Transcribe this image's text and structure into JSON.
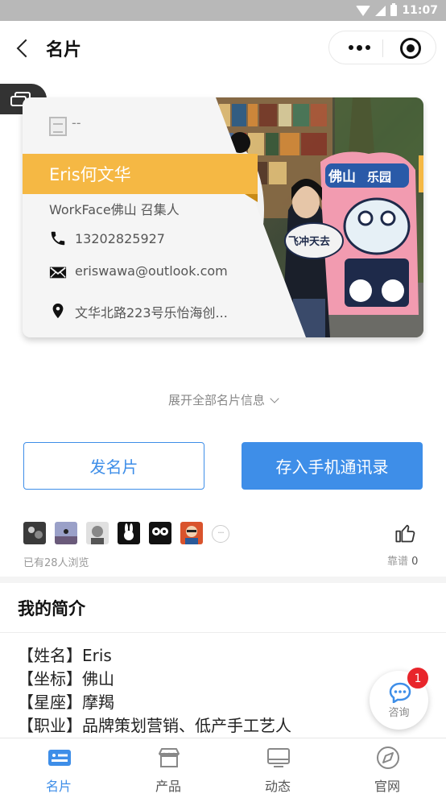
{
  "status_bar": {
    "time": "11:07",
    "icons": [
      "wifi-icon",
      "signal-icon",
      "battery-icon"
    ]
  },
  "header": {
    "back_icon": "chevron-left-icon",
    "title": "名片",
    "more_icon": "more-dots-icon",
    "close_icon": "target-circle-icon"
  },
  "card": {
    "company": "--",
    "name": "Eris何文华",
    "title": "WorkFace佛山 召集人",
    "phone": "13202825927",
    "email": "eriswawa@outlook.com",
    "address": "文华北路223号乐怡海创...",
    "accent_color": "#f5b844",
    "photo_sign": "佛山",
    "photo_sign_2": "乐园",
    "photo_board": "飞冲天去"
  },
  "expand_label": "展开全部名片信息",
  "buttons": {
    "send": "发名片",
    "save": "存入手机通讯录"
  },
  "visitors": {
    "count_text": "已有28人浏览",
    "more": "···",
    "avatars": [
      "avatar-1",
      "avatar-2",
      "avatar-3",
      "avatar-4",
      "avatar-5",
      "avatar-6"
    ]
  },
  "like": {
    "label": "靠谱",
    "count": "0"
  },
  "intro": {
    "title": "我的简介",
    "lines": [
      "【姓名】Eris",
      "【坐标】佛山",
      "【星座】摩羯",
      "【职业】品牌策划营销、低产手工艺人"
    ]
  },
  "consult": {
    "label": "咨询",
    "badge": "1"
  },
  "tabs": [
    {
      "label": "名片",
      "icon": "card-icon",
      "active": true
    },
    {
      "label": "产品",
      "icon": "store-icon",
      "active": false
    },
    {
      "label": "动态",
      "icon": "monitor-icon",
      "active": false
    },
    {
      "label": "官网",
      "icon": "compass-icon",
      "active": false
    }
  ],
  "colors": {
    "primary": "#3e8ee8",
    "badge": "#e8252b"
  }
}
